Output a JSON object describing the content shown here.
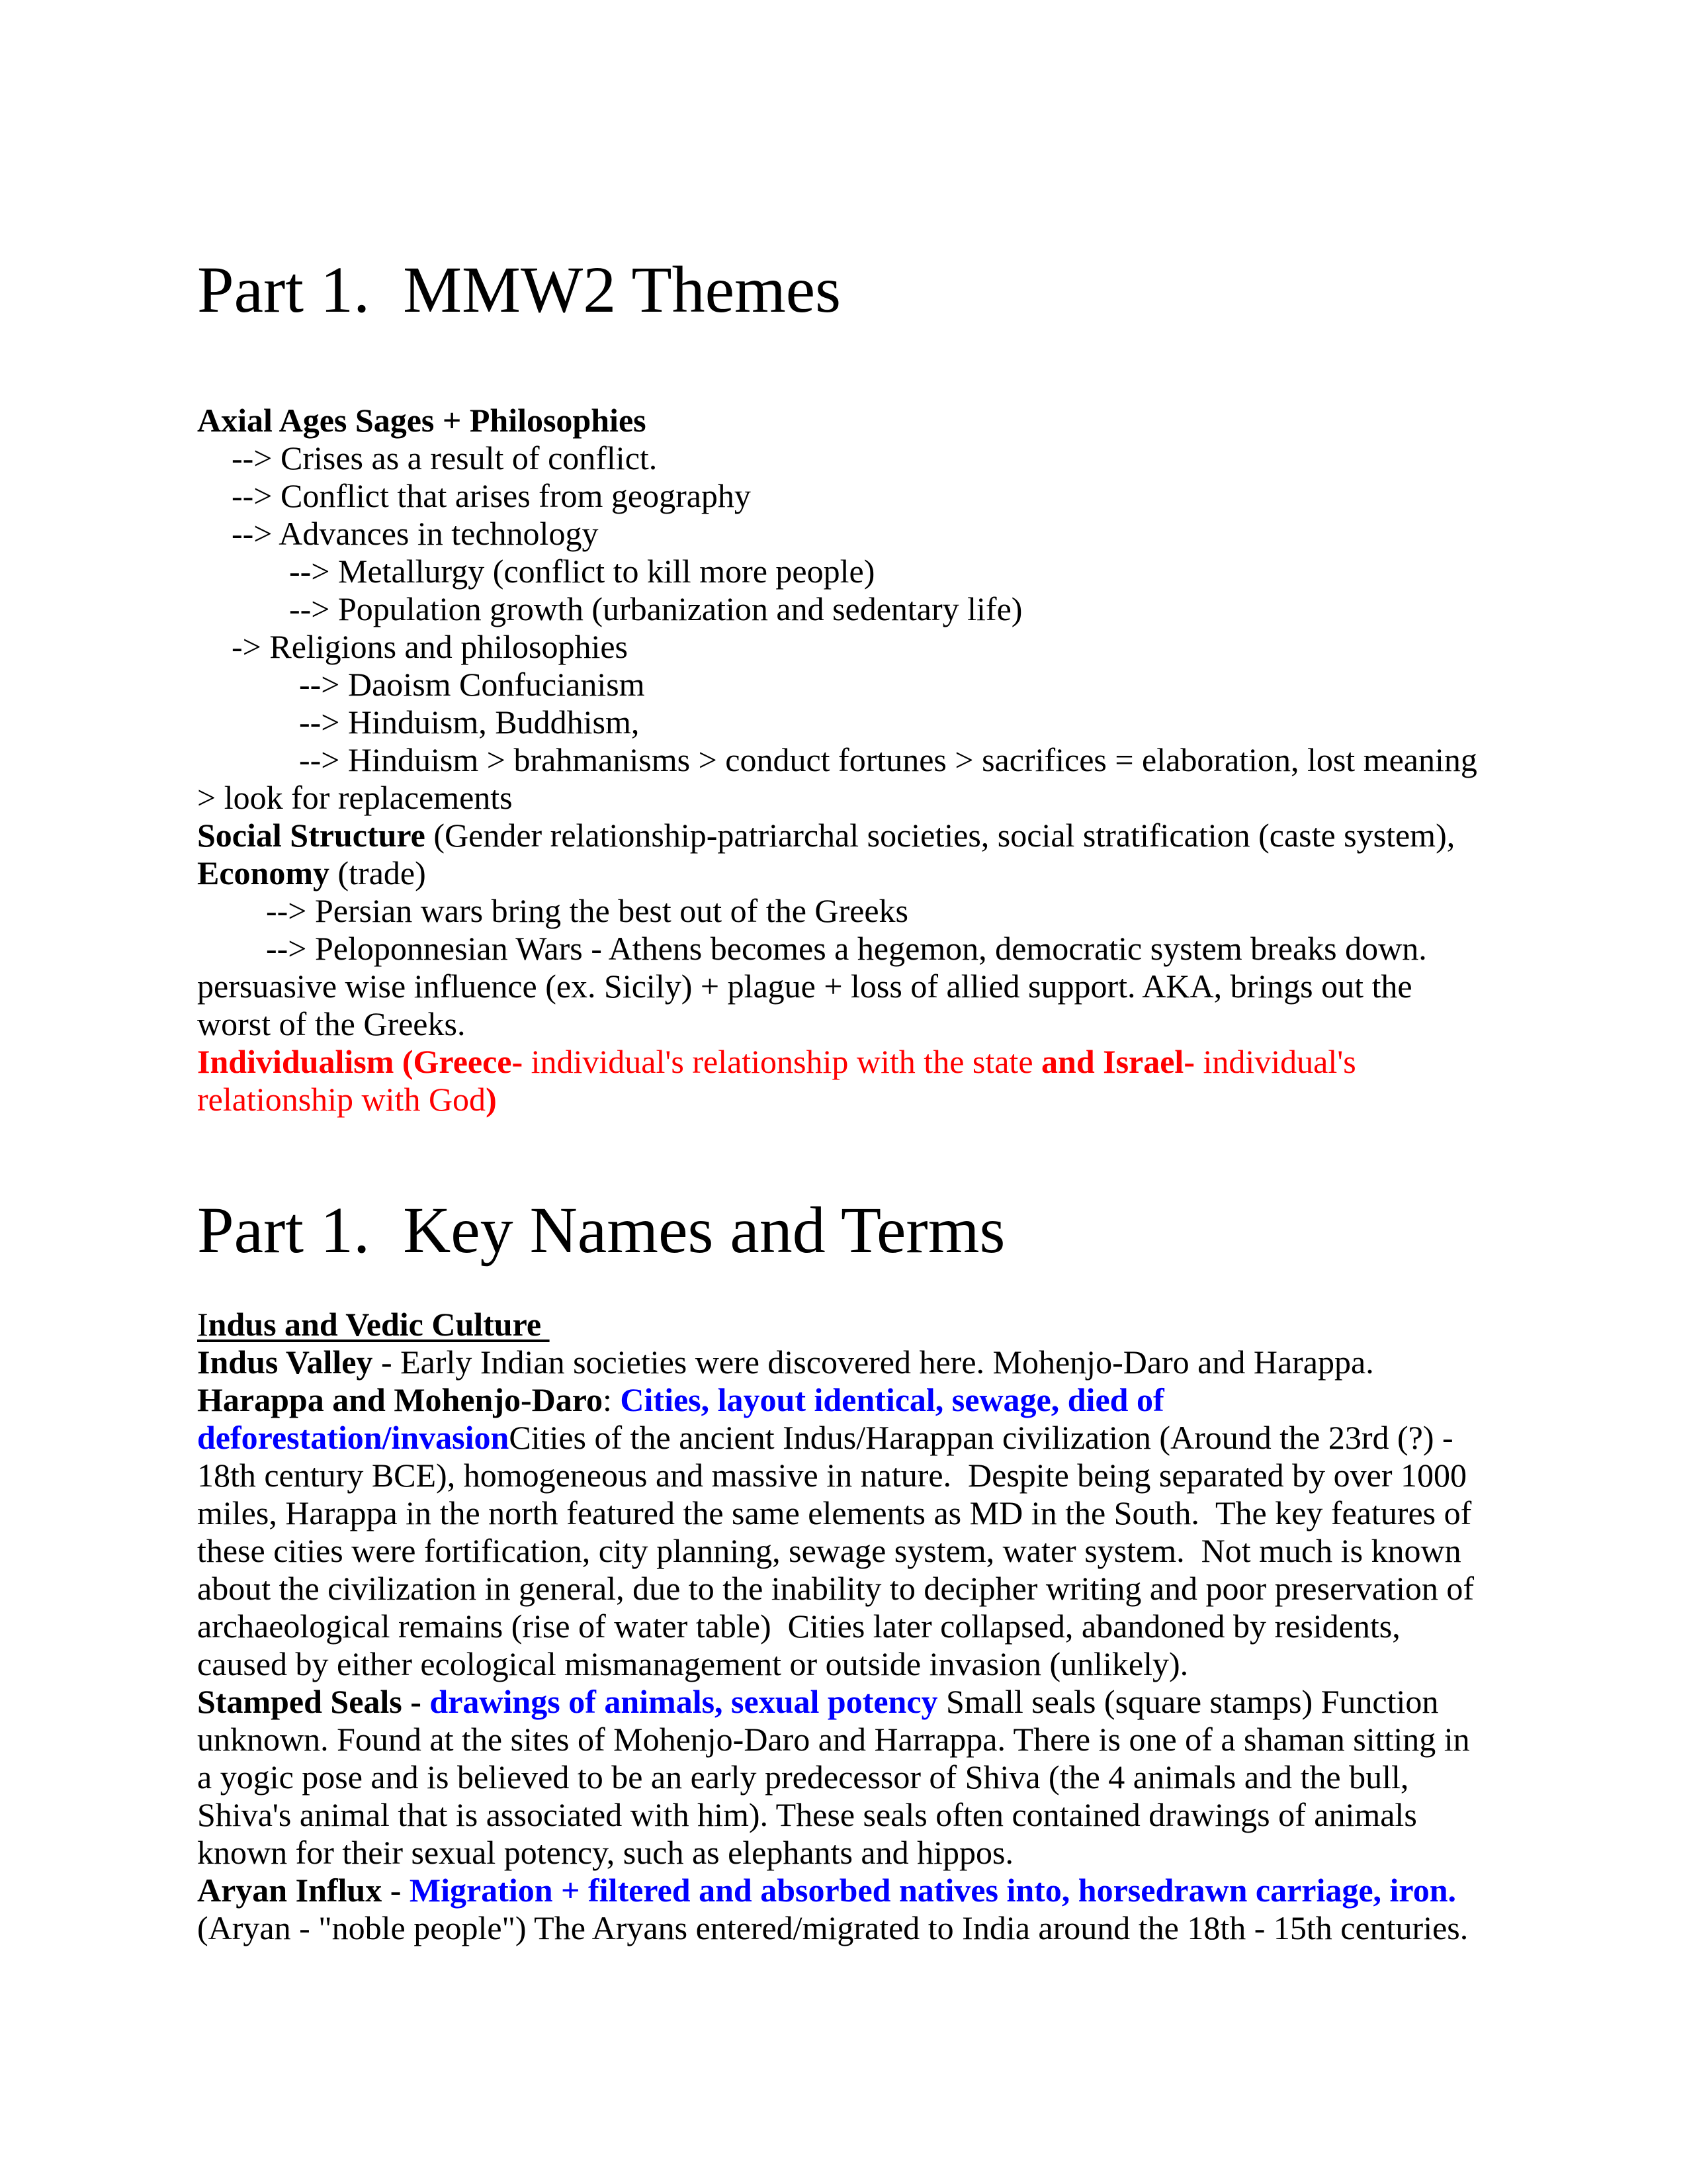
{
  "document": {
    "section1": {
      "title": "Part 1.  MMW2 Themes",
      "axial_heading": "Axial Ages Sages + Philosophies",
      "axial_items": [
        "--> Crises as a result of conflict.",
        "--> Conflict that arises from geography",
        "--> Advances in technology"
      ],
      "tech_subitems": [
        "--> Metallurgy (conflict to kill more people)",
        "--> Population growth (urbanization and sedentary life)"
      ],
      "religions_item": "-> Religions and philosophies",
      "religion_subitems": [
        "--> Daoism Confucianism",
        "--> Hinduism, Buddhism,",
        "--> Hinduism > brahmanisms > conduct fortunes > sacrifices = elaboration, lost meaning"
      ],
      "religion_continuation": "> look for replacements",
      "social_label": "Social Structure",
      "social_text": " (Gender relationship-patriarchal societies, social stratification (caste system),",
      "economy_label": "Economy",
      "economy_text": " (trade)",
      "economy_items": [
        "--> Persian wars bring the best out of the Greeks",
        "--> Peloponnesian Wars - Athens becomes a hegemon, democratic system breaks down."
      ],
      "economy_continuation": [
        "persuasive wise influence (ex. Sicily) + plague + loss of allied support. AKA, brings out the",
        "worst of the Greeks."
      ],
      "individualism": {
        "bold_1": "Individualism (Greece-",
        "text_1": " individual's relationship with the state ",
        "bold_2": "and Israel-",
        "text_2": " individual's",
        "text_3": "relationship with God",
        "bold_3": ")"
      },
      "accent_color": "#ff0000"
    },
    "section2": {
      "title": "Part 1.  Key Names and Terms",
      "subheading_first_letter": "I",
      "subheading_rest": "ndus and Vedic Culture ",
      "entries": {
        "indus_valley": {
          "term": "Indus Valley",
          "text": " - Early Indian societies were discovered here. Mohenjo-Daro and Harappa."
        },
        "harappa": {
          "term": "Harappa and Mohenjo-Daro",
          "separator": ": ",
          "summary_line1": "Cities, layout identical, sewage, died of",
          "summary_line2": "deforestation/invasion",
          "lines": [
            "Cities of the ancient Indus/Harappan civilization (Around the 23rd (?) -",
            "18th century BCE), homogeneous and massive in nature.  Despite being separated by over 1000",
            "miles, Harappa in the north featured the same elements as MD in the South.  The key features of",
            "these cities were fortification, city planning, sewage system, water system.  Not much is known",
            "about the civilization in general, due to the inability to decipher writing and poor preservation of",
            "archaeological remains (rise of water table)  Cities later collapsed, abandoned by residents,",
            "caused by either ecological mismanagement or outside invasion (unlikely)."
          ]
        },
        "stamped_seals": {
          "term": "Stamped Seals - ",
          "summary": "drawings of animals, sexual potency",
          "lines": [
            " Small seals (square stamps) Function",
            "unknown. Found at the sites of Mohenjo-Daro and Harrappa. There is one of a shaman sitting in",
            "a yogic pose and is believed to be an early predecessor of Shiva (the 4 animals and the bull,",
            "Shiva's animal that is associated with him). These seals often contained drawings of animals",
            "known for their sexual potency, such as elephants and hippos."
          ]
        },
        "aryan_influx": {
          "term": "Aryan Influx",
          "separator": " - ",
          "summary": "Migration + filtered and absorbed natives into, horsedrawn carriage, iron.",
          "lines": [
            "(Aryan - \"noble people\") The Aryans entered/migrated to India around the 18th - 15th centuries."
          ]
        }
      },
      "summary_color": "#0000ff"
    }
  }
}
